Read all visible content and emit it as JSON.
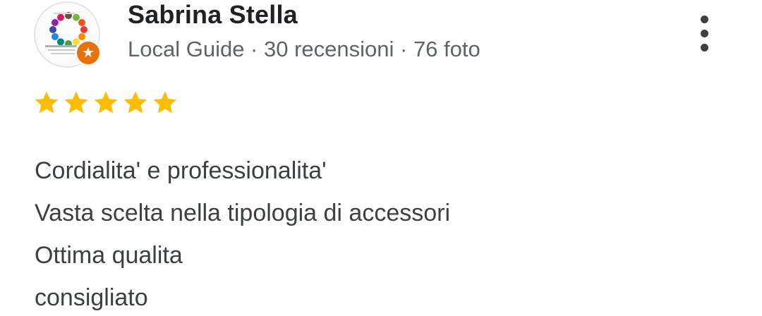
{
  "reviewer": {
    "name": "Sabrina Stella",
    "meta": "Local Guide · 30 recensioni · 76 foto",
    "badge_icon": "star-icon",
    "badge_color": "#e8710a"
  },
  "rating": {
    "value": 5,
    "max": 5,
    "star_color": "#fbbc04",
    "date": ""
  },
  "review": {
    "lines": [
      "Cordialita' e professionalita'",
      "Vasta scelta nella tipologia di accessori",
      "Ottima qualita",
      "consigliato"
    ]
  },
  "menu": {
    "icon": "more-vertical-icon"
  }
}
